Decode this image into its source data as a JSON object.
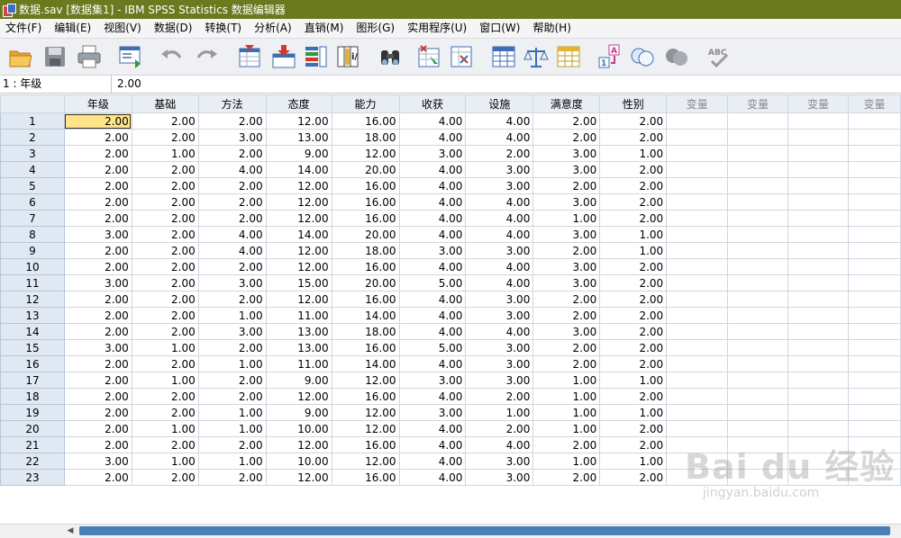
{
  "window": {
    "title": "数据.sav [数据集1] - IBM SPSS Statistics 数据编辑器"
  },
  "menu": [
    "文件(F)",
    "编辑(E)",
    "视图(V)",
    "数据(D)",
    "转换(T)",
    "分析(A)",
    "直销(M)",
    "图形(G)",
    "实用程序(U)",
    "窗口(W)",
    "帮助(H)"
  ],
  "toolbar": [
    "open-folder-icon",
    "save-icon",
    "print-icon",
    "recall-dialog-icon",
    "undo-icon",
    "redo-icon",
    "go-to-case-icon",
    "go-to-variable-icon",
    "variables-icon",
    "insert-cases-icon",
    "find-icon",
    "insert-variable-icon",
    "split-file-icon",
    "weight-cases-icon",
    "select-cases-icon",
    "value-labels-icon",
    "use-variable-sets-icon",
    "show-all-variables-icon",
    "spell-check-icon"
  ],
  "cell_editor": {
    "ref": "1 : 年级",
    "value": "2.00"
  },
  "columns": [
    "年级",
    "基础",
    "方法",
    "态度",
    "能力",
    "收获",
    "设施",
    "满意度",
    "性别"
  ],
  "empty_columns": [
    "变量",
    "变量",
    "变量",
    "变量"
  ],
  "rows": [
    [
      "1",
      "2.00",
      "2.00",
      "2.00",
      "12.00",
      "16.00",
      "4.00",
      "4.00",
      "2.00",
      "2.00"
    ],
    [
      "2",
      "2.00",
      "2.00",
      "3.00",
      "13.00",
      "18.00",
      "4.00",
      "4.00",
      "2.00",
      "2.00"
    ],
    [
      "3",
      "2.00",
      "1.00",
      "2.00",
      "9.00",
      "12.00",
      "3.00",
      "2.00",
      "3.00",
      "1.00"
    ],
    [
      "4",
      "2.00",
      "2.00",
      "4.00",
      "14.00",
      "20.00",
      "4.00",
      "3.00",
      "3.00",
      "2.00"
    ],
    [
      "5",
      "2.00",
      "2.00",
      "2.00",
      "12.00",
      "16.00",
      "4.00",
      "3.00",
      "2.00",
      "2.00"
    ],
    [
      "6",
      "2.00",
      "2.00",
      "2.00",
      "12.00",
      "16.00",
      "4.00",
      "4.00",
      "3.00",
      "2.00"
    ],
    [
      "7",
      "2.00",
      "2.00",
      "2.00",
      "12.00",
      "16.00",
      "4.00",
      "4.00",
      "1.00",
      "2.00"
    ],
    [
      "8",
      "3.00",
      "2.00",
      "4.00",
      "14.00",
      "20.00",
      "4.00",
      "4.00",
      "3.00",
      "1.00"
    ],
    [
      "9",
      "2.00",
      "2.00",
      "4.00",
      "12.00",
      "18.00",
      "3.00",
      "3.00",
      "2.00",
      "1.00"
    ],
    [
      "10",
      "2.00",
      "2.00",
      "2.00",
      "12.00",
      "16.00",
      "4.00",
      "4.00",
      "3.00",
      "2.00"
    ],
    [
      "11",
      "3.00",
      "2.00",
      "3.00",
      "15.00",
      "20.00",
      "5.00",
      "4.00",
      "3.00",
      "2.00"
    ],
    [
      "12",
      "2.00",
      "2.00",
      "2.00",
      "12.00",
      "16.00",
      "4.00",
      "3.00",
      "2.00",
      "2.00"
    ],
    [
      "13",
      "2.00",
      "2.00",
      "1.00",
      "11.00",
      "14.00",
      "4.00",
      "3.00",
      "2.00",
      "2.00"
    ],
    [
      "14",
      "2.00",
      "2.00",
      "3.00",
      "13.00",
      "18.00",
      "4.00",
      "4.00",
      "3.00",
      "2.00"
    ],
    [
      "15",
      "3.00",
      "1.00",
      "2.00",
      "13.00",
      "16.00",
      "5.00",
      "3.00",
      "2.00",
      "2.00"
    ],
    [
      "16",
      "2.00",
      "2.00",
      "1.00",
      "11.00",
      "14.00",
      "4.00",
      "3.00",
      "2.00",
      "2.00"
    ],
    [
      "17",
      "2.00",
      "1.00",
      "2.00",
      "9.00",
      "12.00",
      "3.00",
      "3.00",
      "1.00",
      "1.00"
    ],
    [
      "18",
      "2.00",
      "2.00",
      "2.00",
      "12.00",
      "16.00",
      "4.00",
      "2.00",
      "1.00",
      "2.00"
    ],
    [
      "19",
      "2.00",
      "2.00",
      "1.00",
      "9.00",
      "12.00",
      "3.00",
      "1.00",
      "1.00",
      "1.00"
    ],
    [
      "20",
      "2.00",
      "1.00",
      "1.00",
      "10.00",
      "12.00",
      "4.00",
      "2.00",
      "1.00",
      "2.00"
    ],
    [
      "21",
      "2.00",
      "2.00",
      "2.00",
      "12.00",
      "16.00",
      "4.00",
      "4.00",
      "2.00",
      "2.00"
    ],
    [
      "22",
      "3.00",
      "1.00",
      "1.00",
      "10.00",
      "12.00",
      "4.00",
      "3.00",
      "1.00",
      "1.00"
    ],
    [
      "23",
      "2.00",
      "2.00",
      "2.00",
      "12.00",
      "16.00",
      "4.00",
      "3.00",
      "2.00",
      "2.00"
    ]
  ],
  "selected_cell": {
    "row": 0,
    "col": 0
  },
  "watermark": {
    "main": "Bai du 经验",
    "sub": "jingyan.baidu.com"
  },
  "colors": {
    "titlebar": "#6b7a1e",
    "selected_cell": "#ffe48a",
    "row_header": "#dfe8f3",
    "scroll_thumb": "#4a7fb5"
  }
}
